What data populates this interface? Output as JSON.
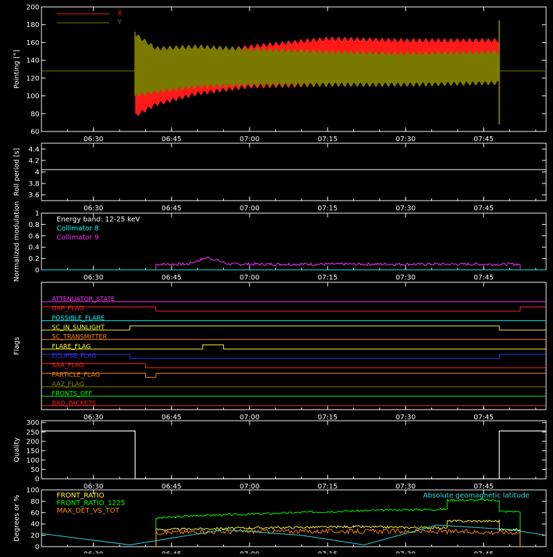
{
  "colors": {
    "background": "#000000",
    "axes": "#ffffff",
    "x_series": "#ff1a1a",
    "y_series": "#7a7a00",
    "white": "#ffffff",
    "cyan": "#00ffff",
    "magenta": "#ff33ff",
    "green": "#00ff00",
    "orange": "#ff8800",
    "yellow": "#ffff33",
    "lightcyan": "#33dddd"
  },
  "time_axis": {
    "start": "06:20",
    "end": "07:57",
    "ticks": [
      "06:30",
      "06:45",
      "07:00",
      "07:15",
      "07:30",
      "07:45"
    ]
  },
  "chart_data": [
    {
      "type": "line",
      "ylabel": "Pointing [°]",
      "ylim": [
        60,
        200
      ],
      "yticks": [
        60,
        80,
        100,
        120,
        140,
        160,
        180,
        200
      ],
      "legend": [
        {
          "name": "X",
          "color": "#ff1a1a"
        },
        {
          "name": "Y",
          "color": "#7a7a00"
        }
      ],
      "series": [
        {
          "name": "X",
          "color": "#ff1a1a",
          "envelope": [
            {
              "t": "06:38",
              "lo": 75,
              "hi": 170
            },
            {
              "t": "06:42",
              "lo": 88,
              "hi": 156
            },
            {
              "t": "06:50",
              "lo": 100,
              "hi": 150
            },
            {
              "t": "07:00",
              "lo": 108,
              "hi": 158
            },
            {
              "t": "07:15",
              "lo": 110,
              "hi": 167
            },
            {
              "t": "07:30",
              "lo": 112,
              "hi": 165
            },
            {
              "t": "07:48",
              "lo": 112,
              "hi": 165
            }
          ]
        },
        {
          "name": "Y",
          "color": "#7a7a00",
          "envelope": [
            {
              "t": "06:38",
              "lo": 98,
              "hi": 172
            },
            {
              "t": "06:42",
              "lo": 102,
              "hi": 156
            },
            {
              "t": "06:50",
              "lo": 108,
              "hi": 158
            },
            {
              "t": "07:00",
              "lo": 110,
              "hi": 155
            },
            {
              "t": "07:15",
              "lo": 110,
              "hi": 152
            },
            {
              "t": "07:30",
              "lo": 110,
              "hi": 150
            },
            {
              "t": "07:48",
              "lo": 112,
              "hi": 152
            }
          ]
        }
      ],
      "baseline": 128
    },
    {
      "type": "line",
      "ylabel": "Roll period [s]",
      "ylim": [
        3.5,
        4.5
      ],
      "yticks": [
        3.6,
        3.8,
        4.0,
        4.2,
        4.4
      ],
      "series": [
        {
          "name": "Roll period",
          "color": "#ffffff",
          "y": 4.04
        }
      ]
    },
    {
      "type": "line",
      "ylabel": "Normalized modulation",
      "ylim": [
        0,
        1
      ],
      "yticks": [
        0.0,
        0.2,
        0.4,
        0.6,
        0.8,
        1.0
      ],
      "legend": [
        {
          "name": "Energy band: 12-25 keV",
          "color": "#ffffff"
        },
        {
          "name": "Collimator 8",
          "color": "#00ffff"
        },
        {
          "name": "Collimator 9",
          "color": "#ff33ff"
        }
      ],
      "series": [
        {
          "name": "Collimator 8",
          "color": "#00ffff",
          "level": 0.0
        },
        {
          "name": "Collimator 9",
          "color": "#ff33ff",
          "start": "06:42",
          "end": "07:52",
          "level": 0.1,
          "bump_t": "06:52",
          "bump": 0.22
        }
      ]
    },
    {
      "type": "flags",
      "ylabel": "Flags",
      "flags": [
        {
          "name": "ATTENUATOR_STATE",
          "color": "#ff33ff",
          "segments": []
        },
        {
          "name": "SAA_FLAG_2",
          "label": "GAP_FLAG",
          "color": "#ff2222",
          "segments": [
            [
              "06:20",
              "06:42",
              1
            ],
            [
              "06:42",
              "07:52",
              0
            ],
            [
              "07:52",
              "07:57",
              1
            ]
          ]
        },
        {
          "name": "POSSIBLE_FLARE",
          "color": "#00ffff",
          "segments": []
        },
        {
          "name": "SC_IN_SUNLIGHT",
          "color": "#ffff33",
          "segments": [
            [
              "06:20",
              "06:37",
              0
            ],
            [
              "06:37",
              "07:48",
              1
            ],
            [
              "07:48",
              "07:57",
              0
            ]
          ]
        },
        {
          "name": "SC_TRANSMITTER",
          "color": "#ff8800",
          "segments": []
        },
        {
          "name": "FLARE_FLAG",
          "color": "#ffff33",
          "segments": [
            [
              "06:20",
              "06:51",
              0
            ],
            [
              "06:51",
              "06:55",
              1
            ],
            [
              "06:55",
              "07:57",
              0
            ]
          ]
        },
        {
          "name": "ECLIPSE_FLAG",
          "color": "#3333ff",
          "segments": [
            [
              "06:20",
              "06:37",
              1
            ],
            [
              "06:37",
              "07:48",
              0
            ],
            [
              "07:48",
              "07:57",
              1
            ]
          ]
        },
        {
          "name": "SAA_FLAG",
          "color": "#ff2222",
          "segments": [
            [
              "06:20",
              "06:40",
              1
            ],
            [
              "06:40",
              "07:57",
              0
            ]
          ]
        },
        {
          "name": "PARTICLE_FLAG",
          "color": "#ff8800",
          "segments": [
            [
              "06:20",
              "06:40",
              1
            ],
            [
              "06:40",
              "06:42",
              0
            ],
            [
              "06:42",
              "07:57",
              1
            ]
          ]
        },
        {
          "name": "AAZ_FLAG",
          "color": "#888800",
          "segments": [
            [
              "06:20",
              "06:37",
              0
            ]
          ]
        },
        {
          "name": "FRONTS_OFF",
          "color": "#00ff00",
          "segments": []
        },
        {
          "name": "BAD_PACKETS",
          "color": "#ff2222",
          "segments": []
        }
      ]
    },
    {
      "type": "line",
      "ylabel": "Quality",
      "ylim": [
        0,
        310
      ],
      "yticks": [
        0,
        50,
        100,
        150,
        200,
        250,
        300
      ],
      "series": [
        {
          "name": "Quality",
          "color": "#ffffff",
          "segments": [
            [
              "06:20",
              "06:38",
              255
            ],
            [
              "06:38",
              "07:48",
              0
            ],
            [
              "07:48",
              "07:57",
              255
            ]
          ]
        }
      ]
    },
    {
      "type": "line",
      "ylabel": "Degrees or %",
      "ylim": [
        0,
        100
      ],
      "yticks": [
        0,
        20,
        40,
        60,
        80,
        100
      ],
      "legend": [
        {
          "name": "FRONT_RATIO",
          "color": "#ffff33"
        },
        {
          "name": "FRONT_RATIO_1225",
          "color": "#00ff00"
        },
        {
          "name": "MAX_DET_VS_TOT",
          "color": "#ff8800"
        },
        {
          "name": "Absolute geomagnetic latitude",
          "color": "#33dddd"
        }
      ],
      "series": [
        {
          "name": "FRONT_RATIO_1225",
          "color": "#00ff00",
          "start": "06:42",
          "end": "07:52",
          "points": [
            [
              "06:42",
              50
            ],
            [
              "06:50",
              55
            ],
            [
              "07:00",
              57
            ],
            [
              "07:15",
              62
            ],
            [
              "07:30",
              65
            ],
            [
              "07:38",
              66
            ],
            [
              "07:38",
              82
            ],
            [
              "07:48",
              82
            ],
            [
              "07:48",
              62
            ],
            [
              "07:52",
              62
            ]
          ]
        },
        {
          "name": "FRONT_RATIO",
          "color": "#ffff33",
          "start": "06:42",
          "end": "07:52",
          "points": [
            [
              "06:42",
              30
            ],
            [
              "07:00",
              33
            ],
            [
              "07:20",
              35
            ],
            [
              "07:38",
              33
            ],
            [
              "07:38",
              45
            ],
            [
              "07:48",
              45
            ],
            [
              "07:48",
              30
            ],
            [
              "07:52",
              30
            ]
          ]
        },
        {
          "name": "MAX_DET_VS_TOT",
          "color": "#ff8800",
          "start": "06:42",
          "end": "07:52",
          "points": [
            [
              "06:42",
              25
            ],
            [
              "07:00",
              27
            ],
            [
              "07:30",
              27
            ],
            [
              "07:52",
              25
            ]
          ]
        },
        {
          "name": "Absolute geomagnetic latitude",
          "color": "#33dddd",
          "points": [
            [
              "06:20",
              23
            ],
            [
              "06:37",
              3
            ],
            [
              "06:55",
              30
            ],
            [
              "07:10",
              20
            ],
            [
              "07:22",
              3
            ],
            [
              "07:36",
              38
            ],
            [
              "07:50",
              30
            ],
            [
              "07:57",
              20
            ]
          ]
        }
      ]
    }
  ]
}
